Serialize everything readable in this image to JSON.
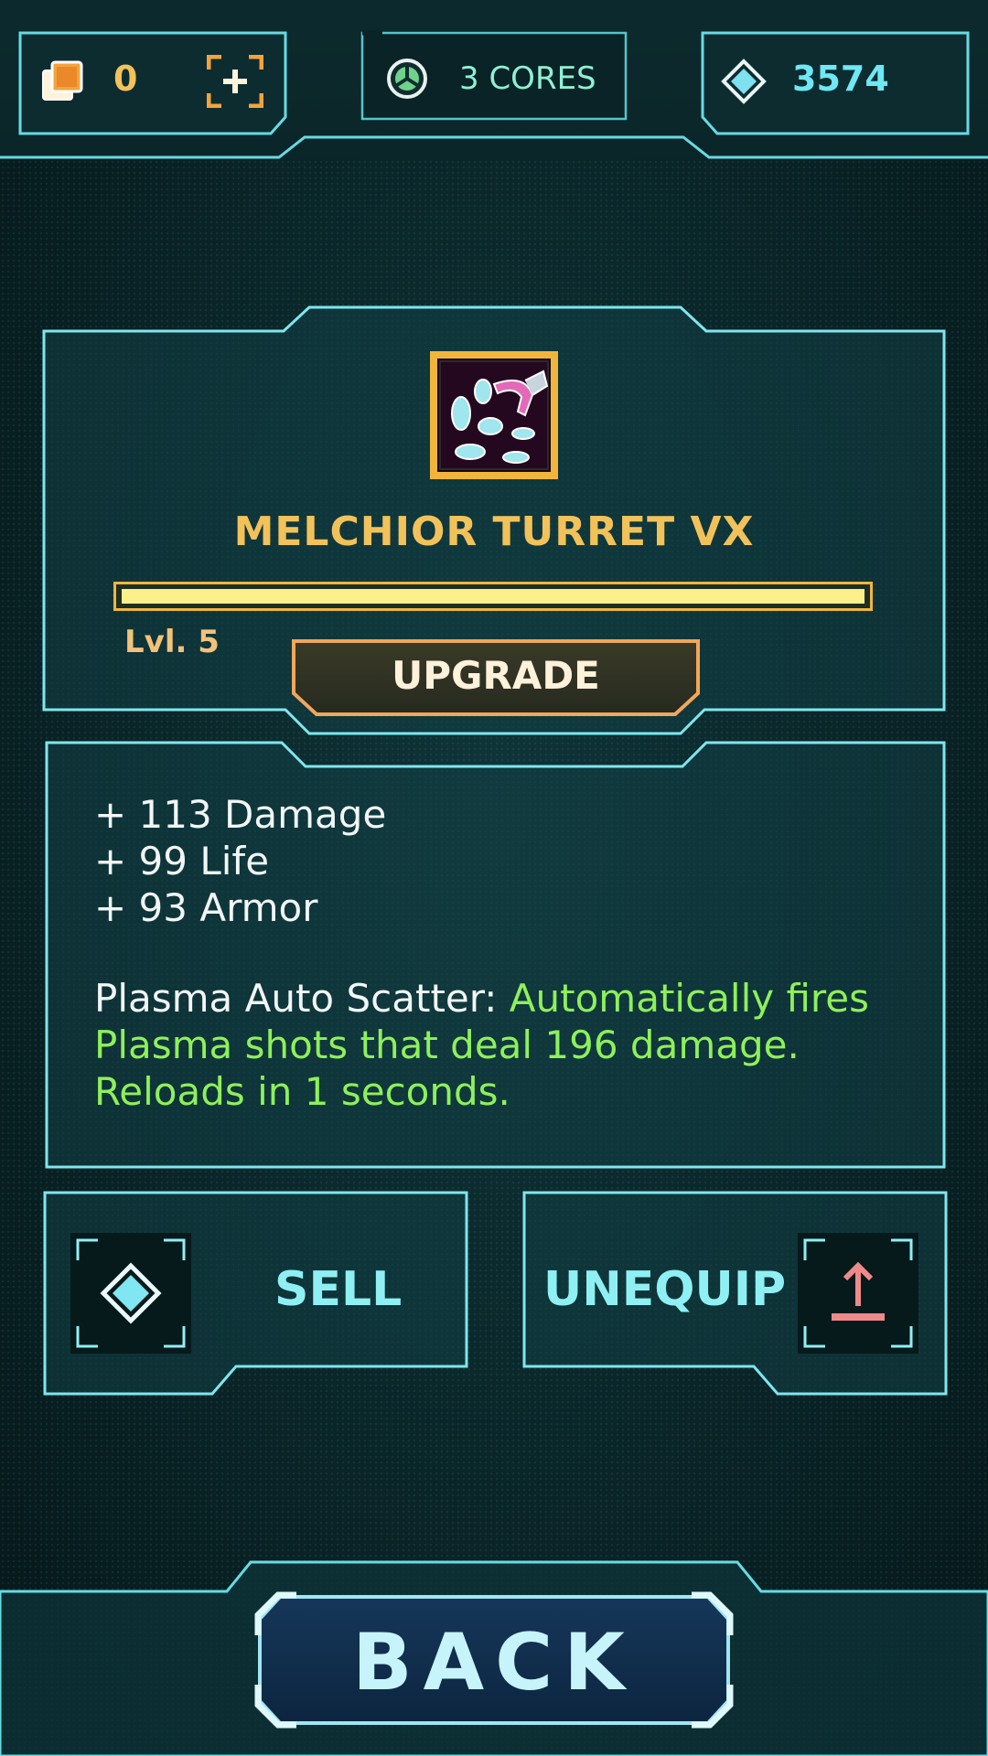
{
  "header": {
    "cards": {
      "count": "0",
      "icon": "cards-icon",
      "add_icon": "add-plus-icon"
    },
    "cores": {
      "label": "3 CORES",
      "icon": "core-icon"
    },
    "gems": {
      "count": "3574",
      "icon": "diamond-icon"
    }
  },
  "item": {
    "icon": "turret-item-icon",
    "name": "MELCHIOR TURRET VX",
    "level_label": "Lvl. 5",
    "level_progress": 1.0,
    "upgrade_label": "UPGRADE"
  },
  "stats": {
    "lines": [
      "+ 113 Damage",
      "+ 99 Life",
      "+ 93 Armor"
    ],
    "ability_name": "Plasma Auto Scatter:",
    "ability_desc": "Automatically fires Plasma shots that deal 196 damage. Reloads in 1 seconds."
  },
  "actions": {
    "sell_label": "SELL",
    "unequip_label": "UNEQUIP"
  },
  "footer": {
    "back_label": "BACK"
  },
  "colors": {
    "accent": "#7fe6ee",
    "gold": "#f2c25a",
    "orange": "#f0a64a",
    "ability_green": "#8ef05a",
    "unequip_pink": "#f08a8a"
  }
}
